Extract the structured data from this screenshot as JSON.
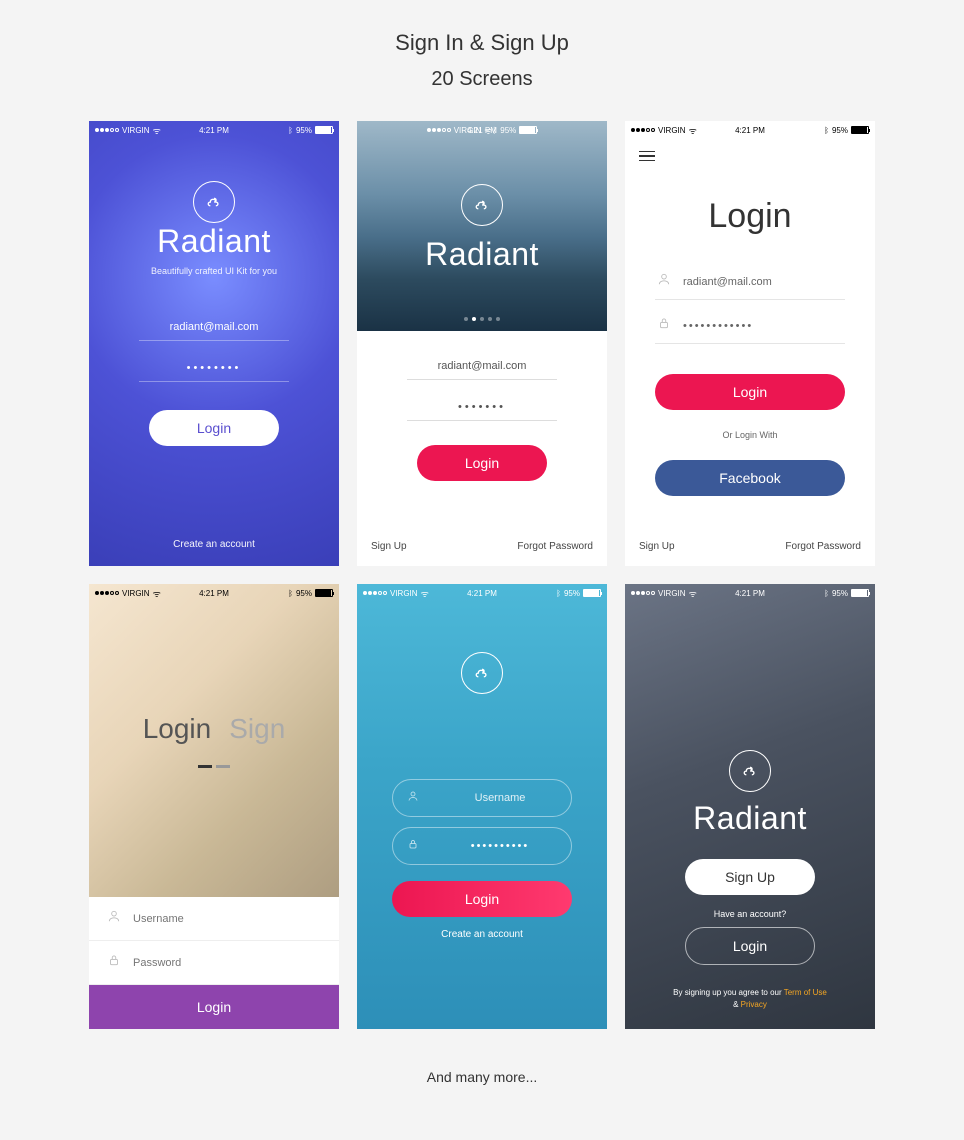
{
  "header": {
    "title": "Sign In & Sign Up",
    "subtitle": "20 Screens"
  },
  "status": {
    "carrier": "VIRGIN",
    "time": "4:21 PM",
    "battery": "95%"
  },
  "s1": {
    "brand": "Radiant",
    "tagline": "Beautifully crafted UI Kit for you",
    "email": "radiant@mail.com",
    "password": "••••••••",
    "login": "Login",
    "create": "Create an account"
  },
  "s2": {
    "brand": "Radiant",
    "email": "radiant@mail.com",
    "password": "•••••••",
    "login": "Login",
    "signup": "Sign Up",
    "forgot": "Forgot Password"
  },
  "s3": {
    "title": "Login",
    "email": "radiant@mail.com",
    "password": "••••••••••••",
    "login": "Login",
    "or": "Or Login With",
    "facebook": "Facebook",
    "signup": "Sign Up",
    "forgot": "Forgot Password"
  },
  "s4": {
    "tab1": "Login",
    "tab2": "Sign",
    "username_ph": "Username",
    "password_ph": "Password",
    "login": "Login"
  },
  "s5": {
    "username_ph": "Username",
    "password": "••••••••••",
    "login": "Login",
    "create": "Create an account"
  },
  "s6": {
    "brand": "Radiant",
    "signup": "Sign Up",
    "have": "Have an account?",
    "login": "Login",
    "terms_pre": "By signing up you agree to our ",
    "terms": "Term of Use",
    "amp": " & ",
    "privacy": "Privacy"
  },
  "footer": "And many more..."
}
